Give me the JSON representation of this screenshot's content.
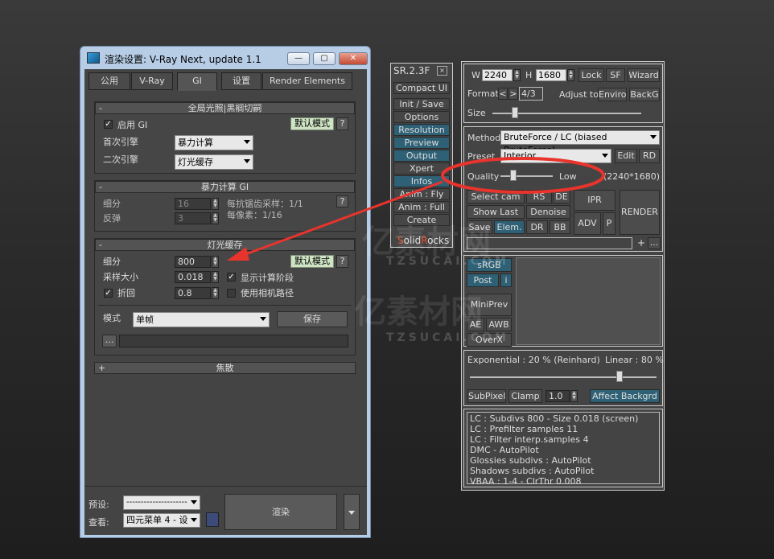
{
  "window": {
    "title": "渲染设置: V-Ray Next, update 1.1",
    "min": "—",
    "max": "▢",
    "close": "✕"
  },
  "tabs": [
    "公用",
    "V-Ray",
    "GI",
    "设置",
    "Render Elements"
  ],
  "gi": {
    "header": "全局光照|黑榈切嗣",
    "enable_label": "启用 GI",
    "default_mode": "默认模式",
    "help": "?",
    "primary_label": "首次引擎",
    "primary_value": "暴力计算",
    "secondary_label": "二次引擎",
    "secondary_value": "灯光缓存"
  },
  "bf": {
    "header": "暴力计算 GI",
    "subdivs_label": "细分",
    "subdivs_value": "16",
    "bounces_label": "反弹",
    "bounces_value": "3",
    "per_aa_label": "每抗锯齿采样：1/1",
    "per_pixel_label": "每像素：1/16",
    "help": "?"
  },
  "lc": {
    "header": "灯光缓存",
    "subdivs_label": "细分",
    "subdivs_value": "800",
    "default_mode": "默认模式",
    "help": "?",
    "sample_label": "采样大小",
    "sample_value": "0.018",
    "show_calc_label": "显示计算阶段",
    "retrace_label": "折回",
    "retrace_value": "0.8",
    "camera_path_label": "使用相机路径",
    "mode_label": "模式",
    "mode_value": "单帧",
    "save_label": "保存",
    "browse_label": "..."
  },
  "caustics": {
    "header": "焦散",
    "sign": "+"
  },
  "bottom": {
    "preset_label": "预设:",
    "preset_value": "---------------------",
    "view_label": "查看:",
    "view_value": "四元菜单 4 - 设",
    "render_label": "渲染"
  },
  "sr": {
    "title": "SR.2.3F",
    "close": "⊠",
    "items": [
      "Compact UI",
      "Init / Save",
      "Options",
      "Resolution",
      "Preview",
      "Output",
      "Xpert",
      "Infos",
      "Anim : Fly",
      "Anim : Full",
      "Create"
    ],
    "brand_a": "S",
    "brand_b": "olid",
    "brand_c": "R",
    "brand_d": "ocks"
  },
  "rp": {
    "w_label": "W",
    "w_value": "2240",
    "h_label": "H",
    "h_value": "1680",
    "lock": "Lock",
    "sf": "SF",
    "wizard": "Wizard",
    "format_label": "Format",
    "fmt_prev": "<",
    "fmt_next": ">",
    "format_value": "4/3",
    "adjust_label": "Adjust to",
    "enviro": "Enviro",
    "backg": "BackG",
    "size_label": "Size",
    "method_label": "Method",
    "method_value": "BruteForce / LC (biased BruteForce)",
    "preset_label": "Preset",
    "preset_value": "Interior",
    "edit": "Edit",
    "rd": "RD",
    "quality_label": "Quality",
    "quality_value": "Low",
    "quality_res": "(2240*1680)",
    "select_cam": "Select cam",
    "rs": "RS",
    "de": "DE",
    "ipr": "IPR",
    "show_last": "Show Last",
    "denoise": "Denoise",
    "render": "RENDER",
    "save": "Save",
    "elem": "Elem.",
    "dr": "DR",
    "bb": "BB",
    "adv": "ADV",
    "p": "P",
    "plus": "+",
    "dots": "...",
    "srgb": "sRGB",
    "post": "Post",
    "i": "i",
    "miniprev": "MiniPrev",
    "ae": "AE",
    "awb": "AWB",
    "overx": "OverX",
    "exp_label": "Exponential : 20 %  (Reinhard)",
    "lin_label": "Linear : 80 %",
    "subpixel": "SubPixel",
    "clamp": "Clamp",
    "clamp_value": "1.0",
    "affect": "Affect Backgrd",
    "log": [
      "LC : Subdivs 800 - Size 0.018 (screen)",
      "LC : Prefilter samples 11",
      "LC : Filter interp.samples  4",
      "DMC - AutoPilot",
      "Glossies subdivs : AutoPilot",
      "Shadows subdivs : AutoPilot",
      "VBAA : 1-4 - ClrThr 0.008"
    ]
  },
  "watermark": {
    "cn1": "亿素材网",
    "en1": "TZSUCAI.COM",
    "cn2": "亿素材网",
    "en2": "TZSUCAI.COM"
  },
  "colors": {
    "annotation_red": "#e8342c",
    "teal_button": "#2f6176",
    "panel_bg": "#444444"
  },
  "sliders": {
    "size": 0.15,
    "quality": 0.25,
    "tonemap_linear": 0.8
  }
}
